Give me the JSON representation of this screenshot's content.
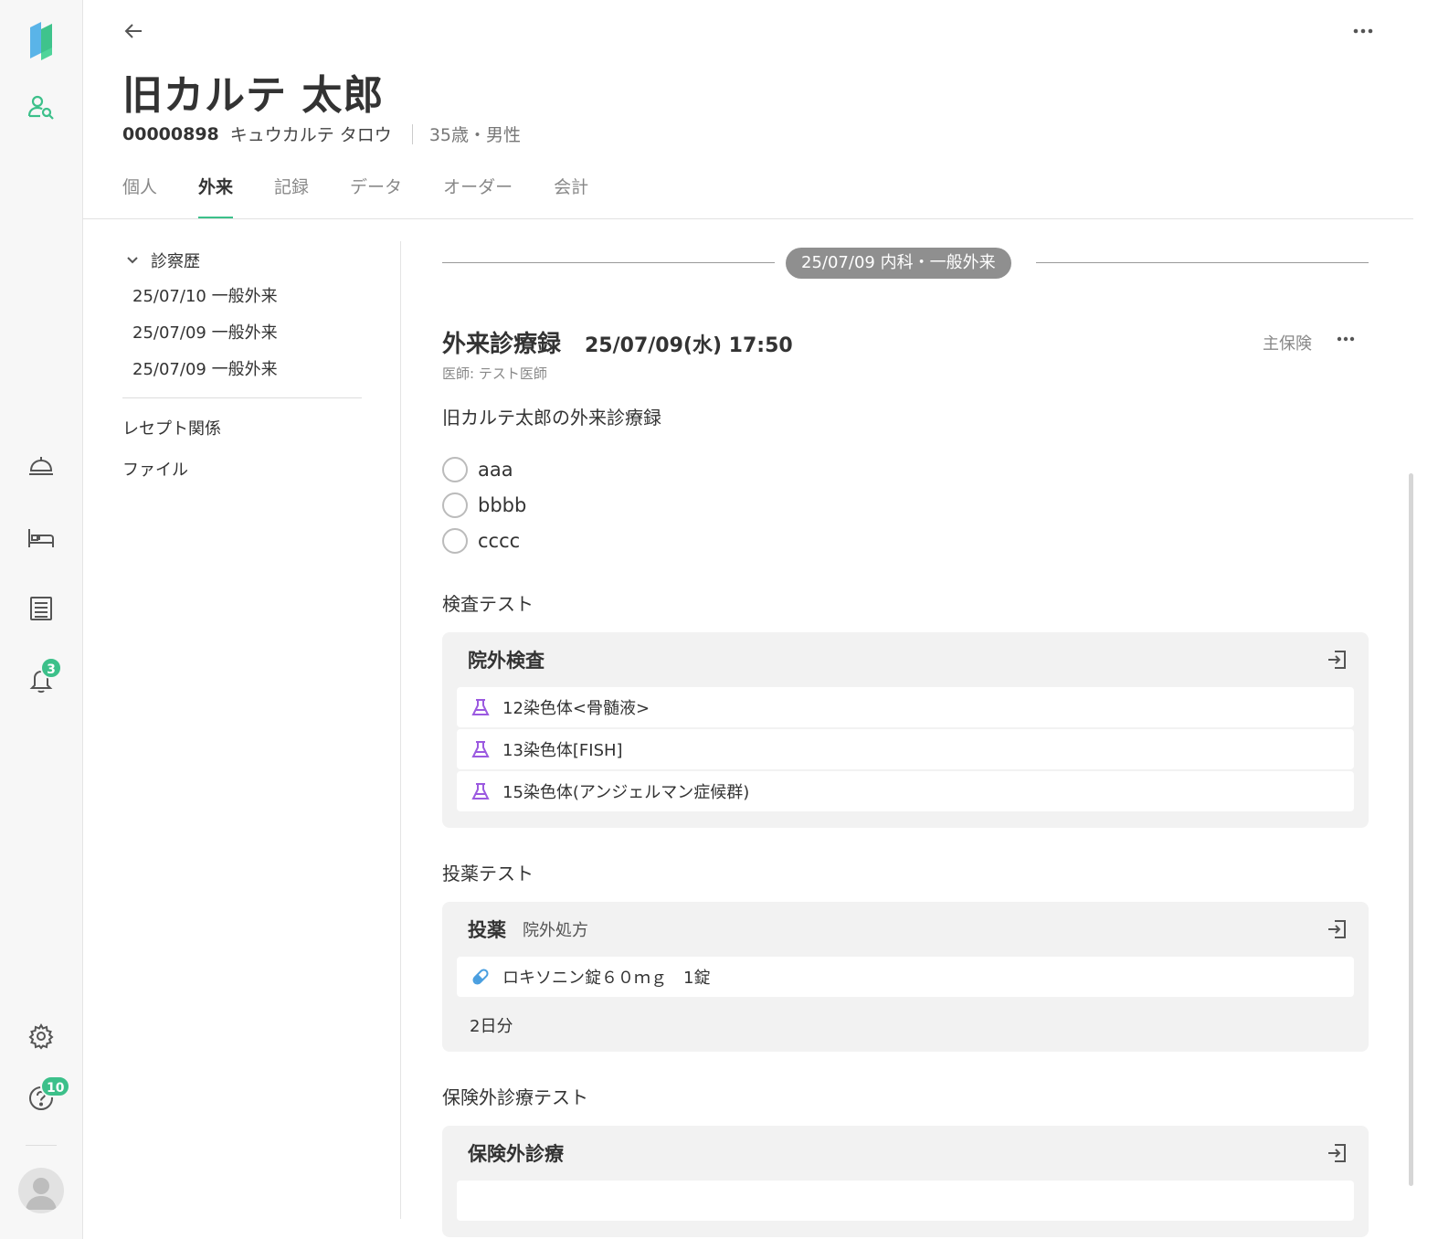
{
  "patient": {
    "name": "旧カルテ 太郎",
    "id": "00000898",
    "kana": "キュウカルテ タロウ",
    "age_sex": "35歳・男性"
  },
  "tabs": [
    {
      "label": "個人"
    },
    {
      "label": "外来"
    },
    {
      "label": "記録"
    },
    {
      "label": "データ"
    },
    {
      "label": "オーダー"
    },
    {
      "label": "会計"
    }
  ],
  "rail": {
    "notification_count": "3",
    "help_count": "10"
  },
  "sidenav": {
    "section_label": "診察歴",
    "visits": [
      {
        "label": "25/07/10 一般外来"
      },
      {
        "label": "25/07/09 一般外来"
      },
      {
        "label": "25/07/09 一般外来"
      }
    ],
    "links": [
      {
        "label": "レセプト関係"
      },
      {
        "label": "ファイル"
      }
    ]
  },
  "record": {
    "date_label": "25/07/09  内科・一般外来",
    "title": "外来診療録",
    "datetime": "25/07/09(水) 17:50",
    "insurance": "主保険",
    "doctor": "医師: テスト医師",
    "note": "旧カルテ太郎の外来診療録",
    "options": [
      {
        "label": "aaa"
      },
      {
        "label": "bbbb"
      },
      {
        "label": "cccc"
      }
    ],
    "sections": {
      "exam_title": "検査テスト",
      "exam_card_title": "院外検査",
      "exam_items": [
        {
          "label": "12染色体<骨髄液>"
        },
        {
          "label": "13染色体[FISH]"
        },
        {
          "label": "15染色体(アンジェルマン症候群)"
        }
      ],
      "med_title": "投薬テスト",
      "med_card_title": "投薬",
      "med_card_sub": "院外処方",
      "med_item": "ロキソニン錠６０ｍｇ　1錠",
      "med_days": "2日分",
      "self_title": "保険外診療テスト",
      "self_card_title": "保険外診療"
    }
  },
  "colors": {
    "accent": "#3cc08a",
    "flask": "#9b59e0",
    "pill": "#4a9fe0"
  }
}
